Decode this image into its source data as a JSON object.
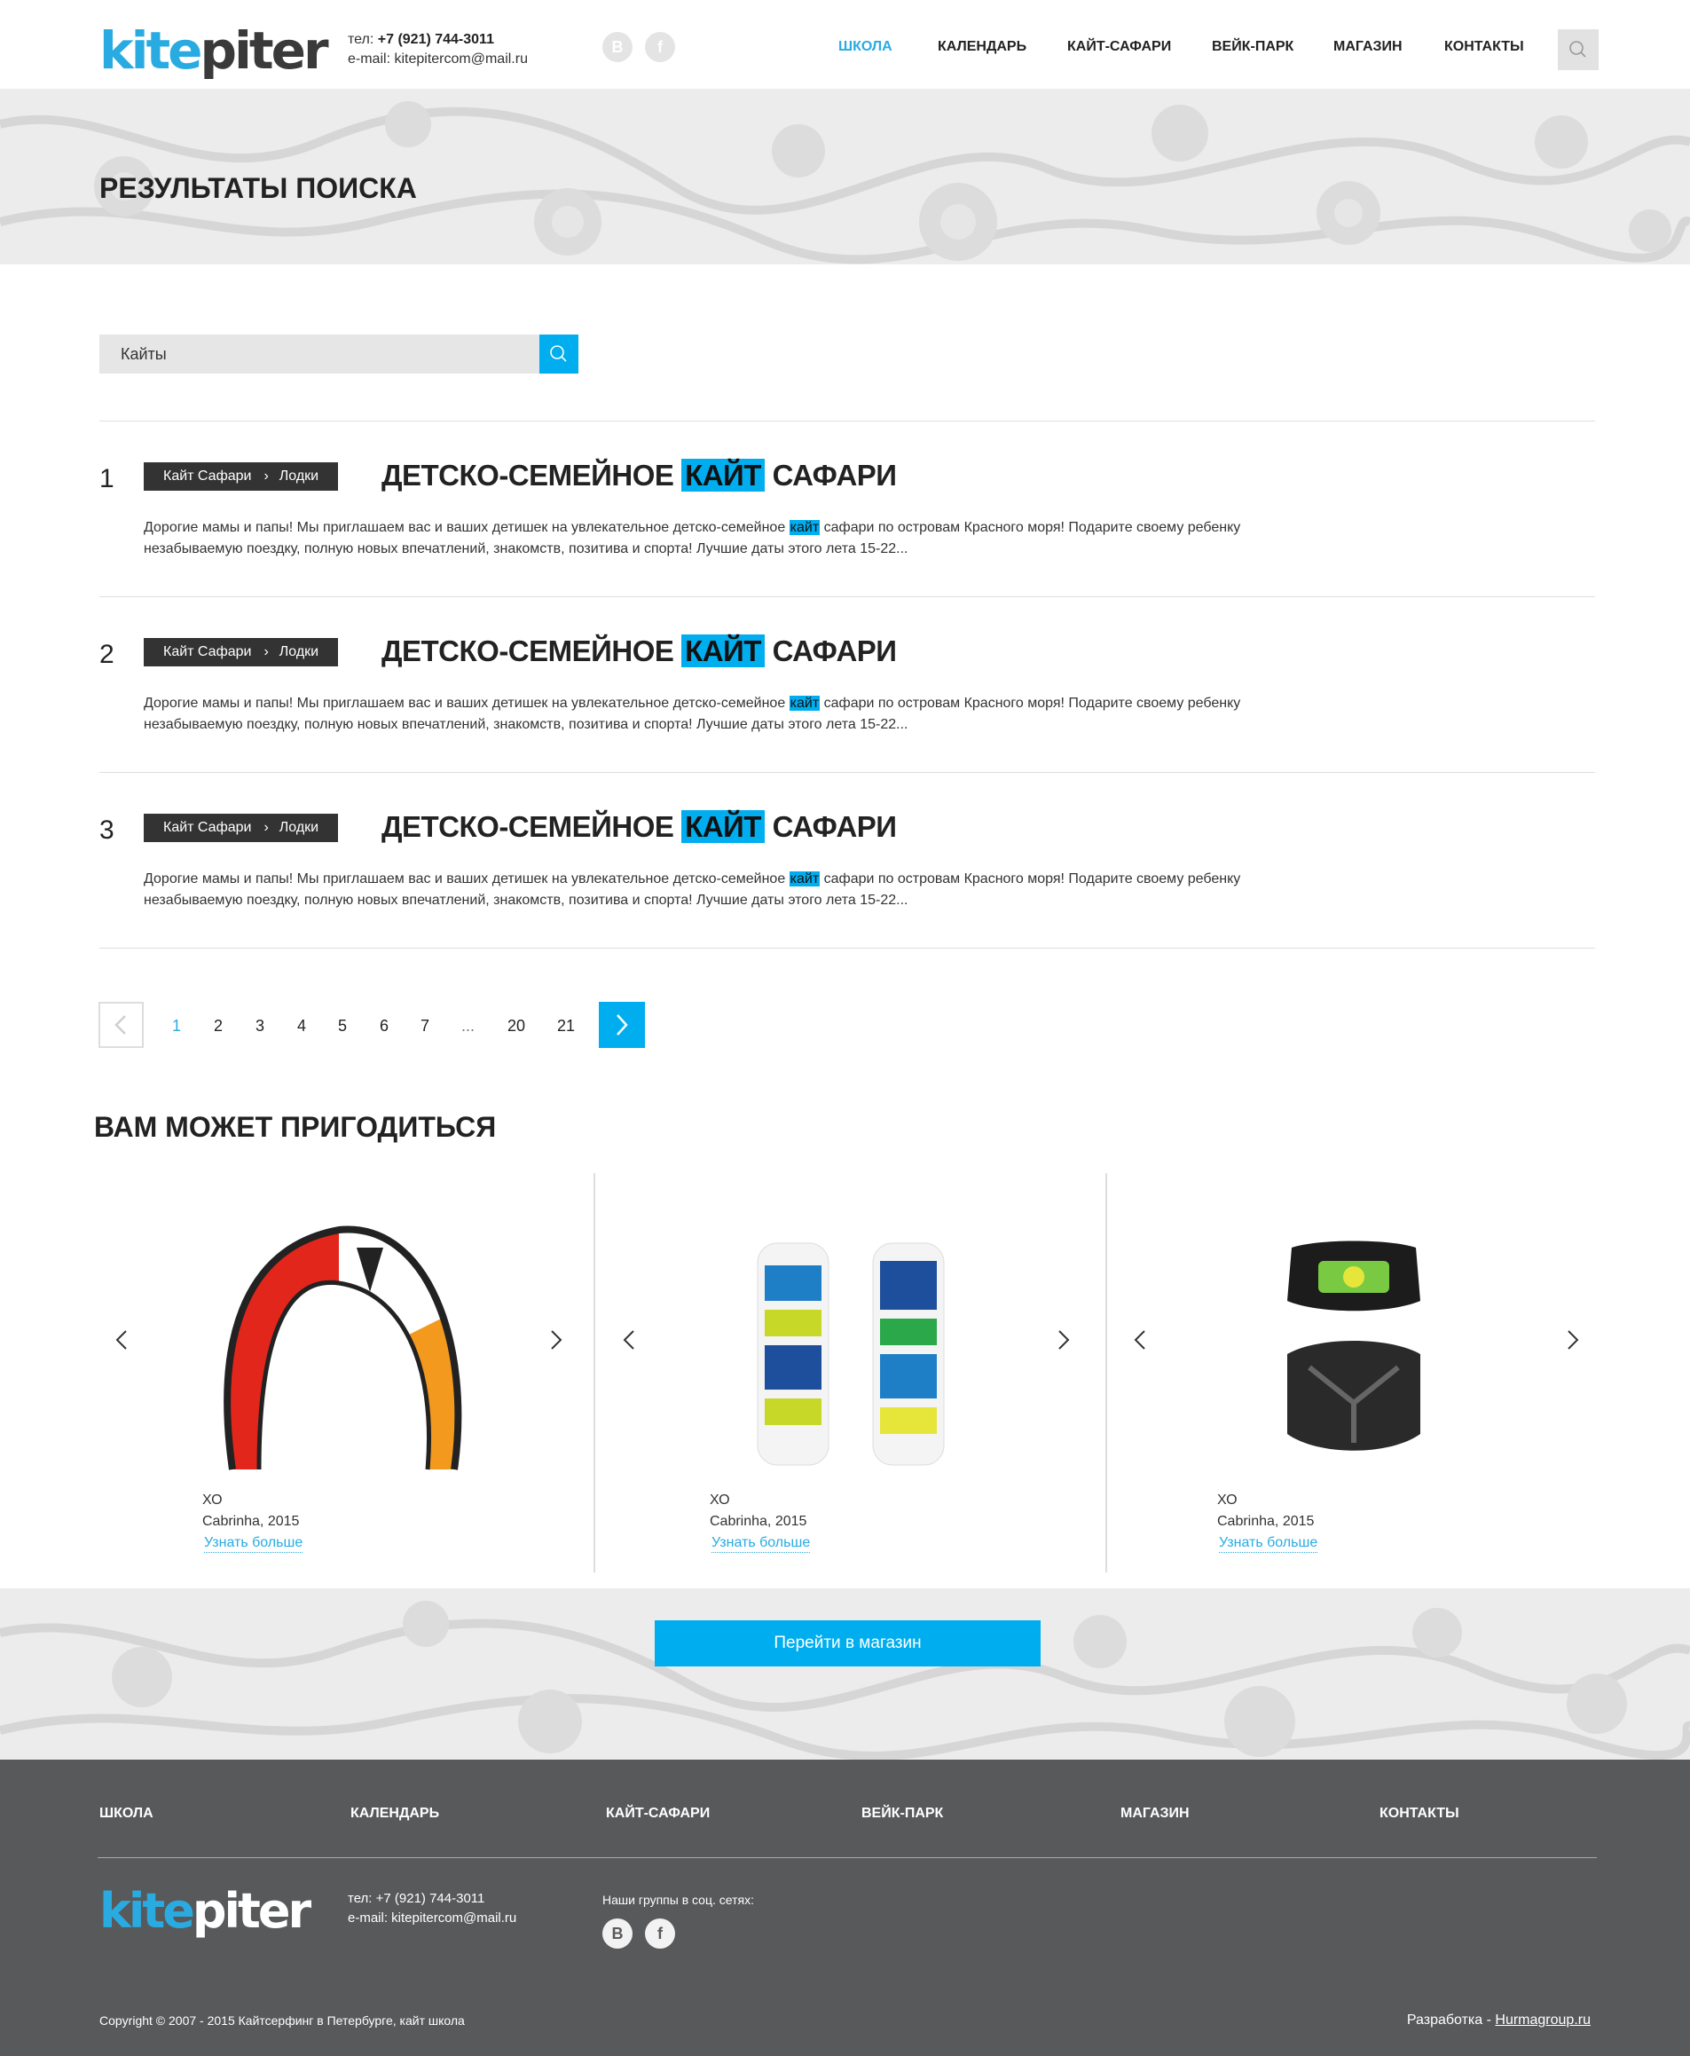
{
  "header": {
    "logo_kite": "kite",
    "logo_piter": "piter",
    "phone_label": "тел:",
    "phone": "+7 (921) 744-3011",
    "email_label": "e-mail:",
    "email": "kitepitercom@mail.ru",
    "social": [
      "В",
      "f"
    ],
    "nav": [
      "ШКОЛА",
      "КАЛЕНДАРЬ",
      "КАЙТ-САФАРИ",
      "ВЕЙК-ПАРК",
      "МАГАЗИН",
      "КОНТАКТЫ"
    ],
    "nav_active": "ШКОЛА"
  },
  "page": {
    "title": "РЕЗУЛЬТАТЫ ПОИСКА"
  },
  "search": {
    "value": "Кайты"
  },
  "results": [
    {
      "number": "1",
      "crumb_1": "Кайт Сафари",
      "crumb_2": "Лодки",
      "title_before": "ДЕТСКО-СЕМЕЙНОЕ",
      "title_highlight": "КАЙТ",
      "title_after": "САФАРИ",
      "text_before": "Дорогие мамы и папы! Мы приглашаем вас и ваших детишек на увлекательное детско-семейное",
      "text_highlight": "кайт",
      "text_after": "сафари по островам Красного моря! Подарите своему ребенку незабываемую поездку, полную новых впечатлений, знакомств, позитива и спорта! Лучшие даты этого лета 15-22..."
    },
    {
      "number": "2",
      "crumb_1": "Кайт Сафари",
      "crumb_2": "Лодки",
      "title_before": "ДЕТСКО-СЕМЕЙНОЕ",
      "title_highlight": "КАЙТ",
      "title_after": "САФАРИ",
      "text_before": "Дорогие мамы и папы! Мы приглашаем вас и ваших детишек на увлекательное детско-семейное",
      "text_highlight": "кайт",
      "text_after": "сафари по островам Красного моря! Подарите своему ребенку незабываемую поездку, полную новых впечатлений, знакомств, позитива и спорта! Лучшие даты этого лета 15-22..."
    },
    {
      "number": "3",
      "crumb_1": "Кайт Сафари",
      "crumb_2": "Лодки",
      "title_before": "ДЕТСКО-СЕМЕЙНОЕ",
      "title_highlight": "КАЙТ",
      "title_after": "САФАРИ",
      "text_before": "Дорогие мамы и папы! Мы приглашаем вас и ваших детишек на увлекательное детско-семейное",
      "text_highlight": "кайт",
      "text_after": "сафари по островам Красного моря! Подарите своему ребенку незабываемую поездку, полную новых впечатлений, знакомств, позитива и спорта! Лучшие даты этого лета 15-22..."
    }
  ],
  "pagination": {
    "pages": [
      "1",
      "2",
      "3",
      "4",
      "5",
      "6",
      "7",
      "...",
      "20",
      "21"
    ],
    "current": "1"
  },
  "related": {
    "title": "ВАМ МОЖЕТ ПРИГОДИТЬСЯ",
    "products": [
      {
        "name": "ХО",
        "subtitle": "Cabrinha, 2015",
        "link": "Узнать больше",
        "image": "kite-image"
      },
      {
        "name": "ХО",
        "subtitle": "Cabrinha, 2015",
        "link": "Узнать больше",
        "image": "kiteboard-image"
      },
      {
        "name": "ХО",
        "subtitle": "Cabrinha, 2015",
        "link": "Узнать больше",
        "image": "harness-image"
      }
    ],
    "shop_button": "Перейти в магазин"
  },
  "footer": {
    "nav": [
      "ШКОЛА",
      "КАЛЕНДАРЬ",
      "КАЙТ-САФАРИ",
      "ВЕЙК-ПАРК",
      "МАГАЗИН",
      "КОНТАКТЫ"
    ],
    "phone_line": "тел: +7 (921) 744-3011",
    "email_line": "e-mail: kitepitercom@mail.ru",
    "social_title": "Наши группы в соц. сетях:",
    "social": [
      "В",
      "f"
    ],
    "copyright": "Copyright © 2007 - 2015 Кайтсерфинг в Петербурге, кайт школа",
    "dev_label": "Разработка -",
    "dev_link": "Hurmagroup.ru"
  },
  "colors": {
    "accent": "#00aeef",
    "footer_bg": "#58595b",
    "crumb_bg": "#333333"
  }
}
